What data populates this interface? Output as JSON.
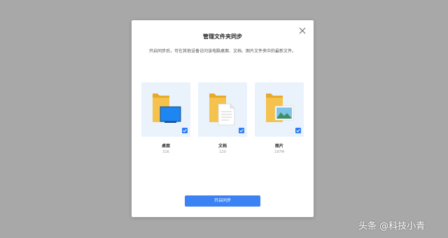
{
  "dialog": {
    "title": "管理文件夹同步",
    "description": "开启同步后，可在其他设备访问该电脑桌面、文档、图片文件夹中的最新文件。",
    "folders": [
      {
        "name": "桌面",
        "size": "31K",
        "checked": true,
        "icon": "desktop-folder-icon"
      },
      {
        "name": "文档",
        "size": "120",
        "checked": true,
        "icon": "documents-folder-icon"
      },
      {
        "name": "图片",
        "size": "197M",
        "checked": true,
        "icon": "pictures-folder-icon"
      }
    ],
    "sync_button": "开启同步",
    "close_icon": "close-icon"
  },
  "watermark": "头条 @科技小青",
  "colors": {
    "backdrop": "#a8a8a8",
    "accent": "#3b83f5",
    "card_bg": "#eaf3fc",
    "folder_yellow": "#f5c34d"
  }
}
